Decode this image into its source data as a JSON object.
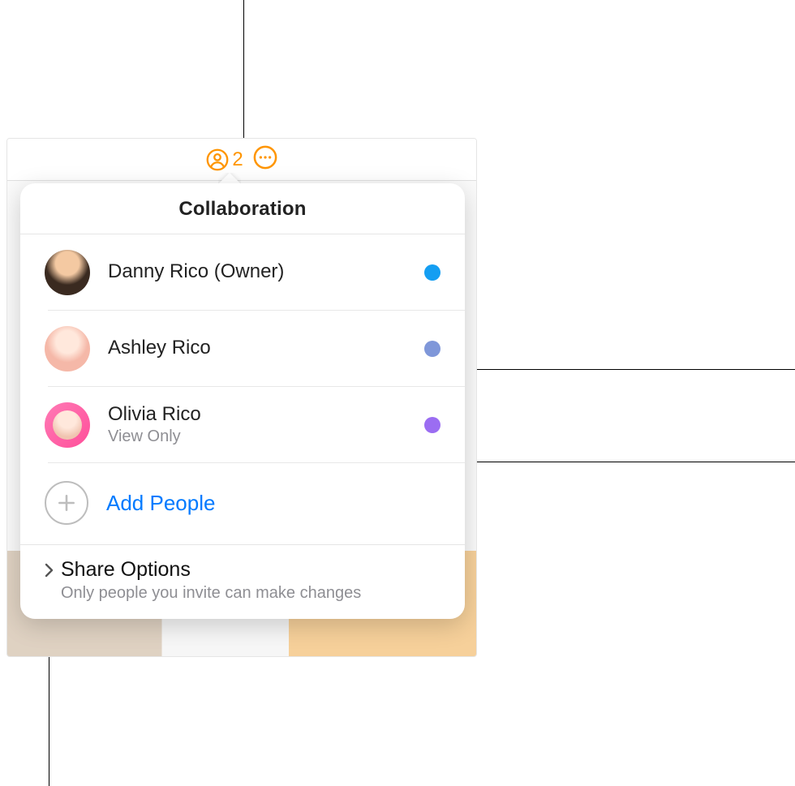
{
  "toolbar": {
    "people_count": "2"
  },
  "popover": {
    "title": "Collaboration",
    "people": [
      {
        "name": "Danny Rico (Owner)",
        "sub": "",
        "dot": "#149ef2"
      },
      {
        "name": "Ashley Rico",
        "sub": "",
        "dot": "#7f97d9"
      },
      {
        "name": "Olivia Rico",
        "sub": "View Only",
        "dot": "#9b6df2"
      }
    ],
    "add_label": "Add People",
    "share": {
      "title": "Share Options",
      "subtitle": "Only people you invite can make changes"
    }
  }
}
